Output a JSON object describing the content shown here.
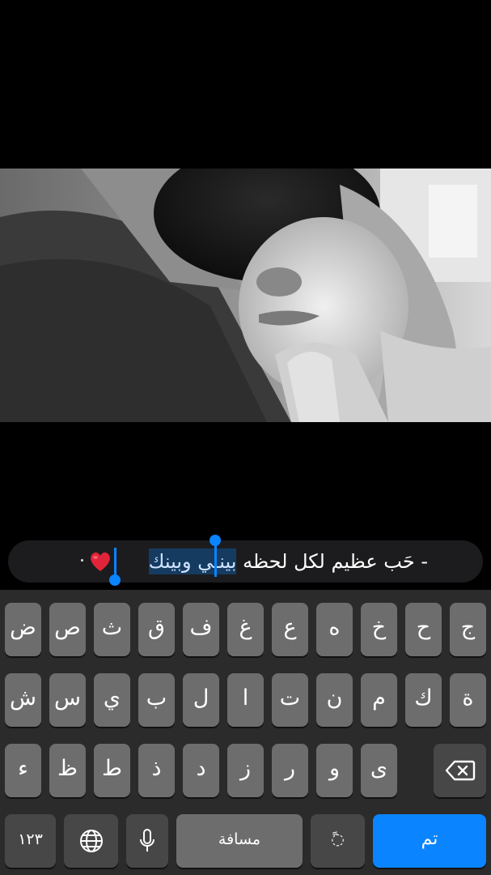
{
  "caption": {
    "prefix": "- حَب عظيم لكل لحظه",
    "selected": "بينـي وبينك",
    "suffix": ".",
    "emoji_name": "red-heart-emoji"
  },
  "keyboard": {
    "row1": [
      "ج",
      "ح",
      "خ",
      "ه",
      "ع",
      "غ",
      "ف",
      "ق",
      "ث",
      "ص",
      "ض"
    ],
    "row2": [
      "ة",
      "ك",
      "م",
      "ن",
      "ت",
      "ا",
      "ل",
      "ب",
      "ي",
      "س",
      "ش"
    ],
    "row3": [
      "ى",
      "و",
      "ر",
      "ز",
      "د",
      "ذ",
      "ط",
      "ظ",
      "ء"
    ],
    "delete_icon": "backspace-icon",
    "row4": {
      "numbers_label": "١٢٣",
      "globe_icon": "globe-icon",
      "mic_icon": "microphone-icon",
      "space_label": "مسافة",
      "diacritic_label": "ً◌",
      "done_label": "تم"
    }
  },
  "colors": {
    "accent": "#0a84ff",
    "key": "#6d6d6d",
    "key_dark": "#474747",
    "keyboard_bg": "#2b2b2b",
    "caption_bg": "#1c1c1e"
  }
}
